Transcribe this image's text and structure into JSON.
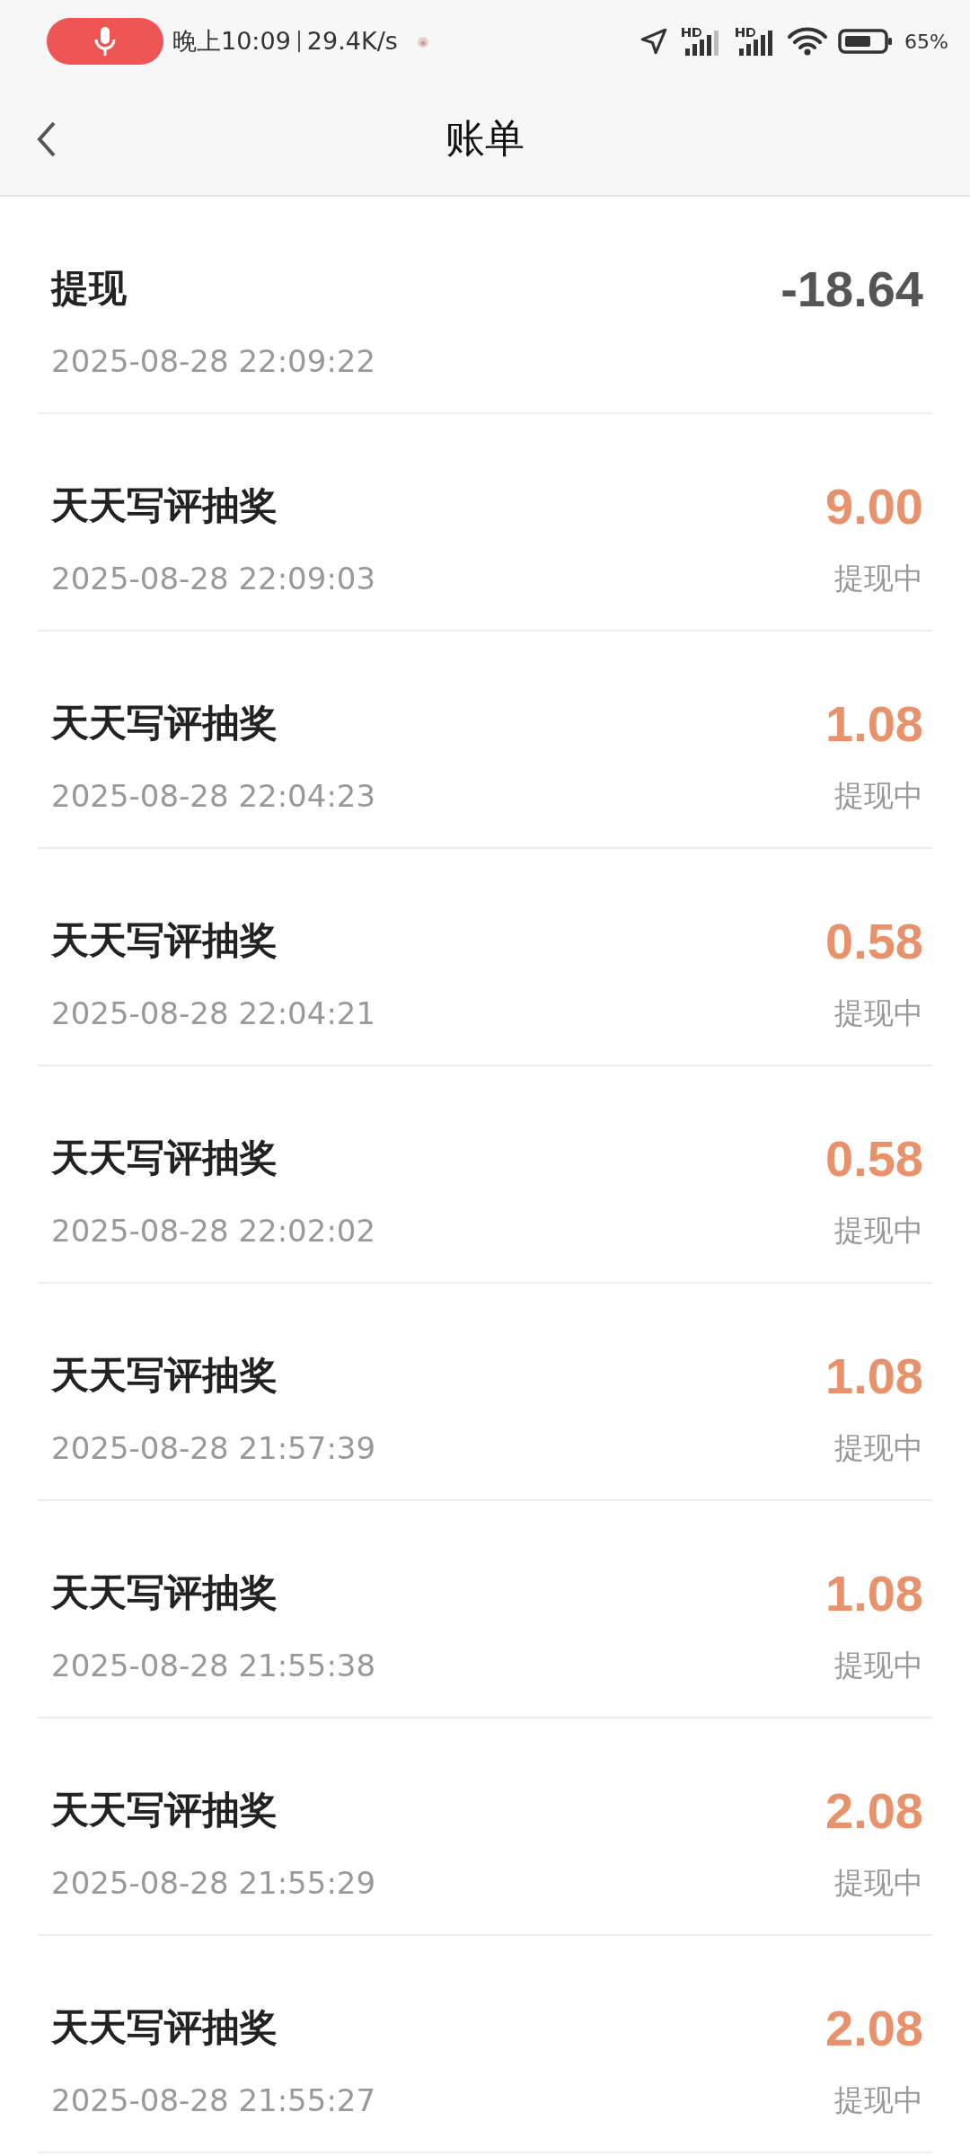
{
  "status_bar": {
    "time": "晚上10:09",
    "speed": "29.4K/s",
    "battery": "65%"
  },
  "header": {
    "title": "账单"
  },
  "records": [
    {
      "title": "提现",
      "time": "2025-08-28 22:09:22",
      "amount": "-18.64",
      "kind": "expense"
    },
    {
      "title": "天天写评抽奖",
      "time": "2025-08-28 22:09:03",
      "amount": "9.00",
      "kind": "income",
      "status": "提现中"
    },
    {
      "title": "天天写评抽奖",
      "time": "2025-08-28 22:04:23",
      "amount": "1.08",
      "kind": "income",
      "status": "提现中"
    },
    {
      "title": "天天写评抽奖",
      "time": "2025-08-28 22:04:21",
      "amount": "0.58",
      "kind": "income",
      "status": "提现中"
    },
    {
      "title": "天天写评抽奖",
      "time": "2025-08-28 22:02:02",
      "amount": "0.58",
      "kind": "income",
      "status": "提现中"
    },
    {
      "title": "天天写评抽奖",
      "time": "2025-08-28 21:57:39",
      "amount": "1.08",
      "kind": "income",
      "status": "提现中"
    },
    {
      "title": "天天写评抽奖",
      "time": "2025-08-28 21:55:38",
      "amount": "1.08",
      "kind": "income",
      "status": "提现中"
    },
    {
      "title": "天天写评抽奖",
      "time": "2025-08-28 21:55:29",
      "amount": "2.08",
      "kind": "income",
      "status": "提现中"
    },
    {
      "title": "天天写评抽奖",
      "time": "2025-08-28 21:55:27",
      "amount": "2.08",
      "kind": "income",
      "status": "提现中"
    }
  ]
}
